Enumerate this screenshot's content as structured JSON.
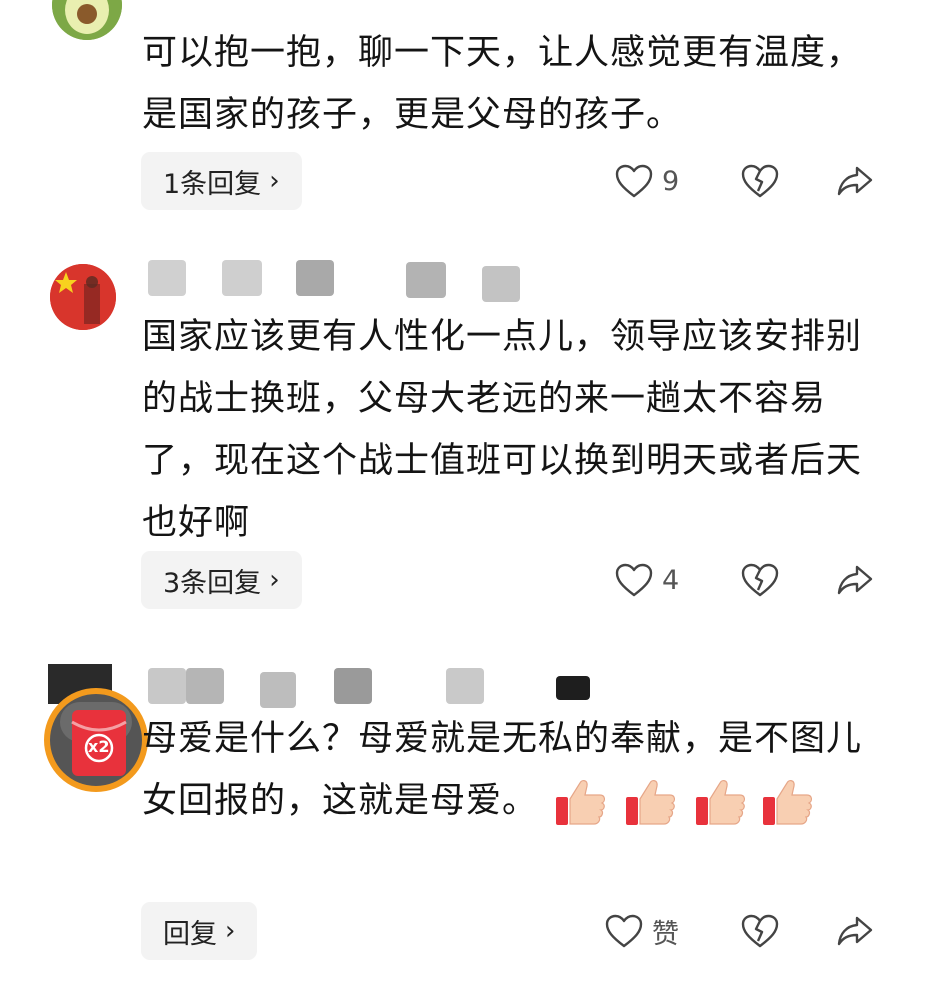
{
  "comments": [
    {
      "text": "可以抱一抱，聊一下天，让人感觉更有温度，是国家的孩子，更是父母的孩子。",
      "reply_label": "1条回复",
      "like_count": "9"
    },
    {
      "text": "国家应该更有人性化一点儿，领导应该安排别的战士换班，父母大老远的来一趟太不容易了，现在这个战士值班可以换到明天或者后天也好啊",
      "reply_label": "3条回复",
      "like_count": "4"
    },
    {
      "text": "母爱是什么？母爱就是无私的奉献，是不图儿女回报的，这就是母爱。",
      "reply_label": "回复",
      "like_count": "赞",
      "emoji": [
        "thumbs-up",
        "thumbs-up",
        "thumbs-up",
        "thumbs-up"
      ]
    }
  ],
  "red_packet_badge": "x2",
  "icons": [
    "heart-outline-icon",
    "broken-heart-icon",
    "share-arrow-icon",
    "chevron-right-icon"
  ],
  "colors": {
    "reply_bg": "#f3f3f3",
    "accent_orange": "#f39a1d",
    "packet_red": "#e8323c"
  }
}
